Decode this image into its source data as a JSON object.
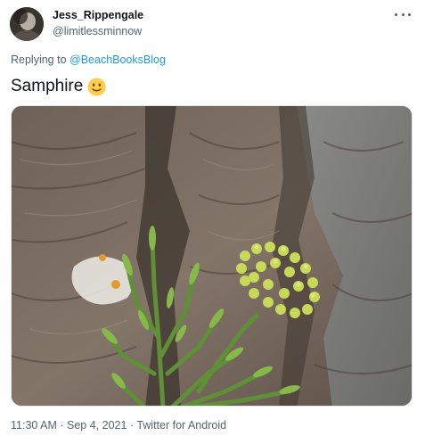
{
  "author": {
    "display_name": "Jess_Rippengale",
    "handle": "@limitlessminnow",
    "avatar_icon": "avatar-photo"
  },
  "more_icon": "more-options-icon",
  "reply": {
    "prefix": "Replying to ",
    "mention": "@BeachBooksBlog"
  },
  "tweet": {
    "text": "Samphire",
    "emoji": "slightly-smiling-face-icon"
  },
  "media": {
    "type": "photo",
    "subject": "samphire plant growing from rock crevice"
  },
  "meta": {
    "time": "11:30 AM",
    "separator1": " · ",
    "date": "Sep 4, 2021",
    "separator2": " · ",
    "source": "Twitter for Android"
  },
  "colors": {
    "link": "#1d9bf0",
    "secondary_text": "#536471",
    "primary_text": "#0f1419"
  }
}
